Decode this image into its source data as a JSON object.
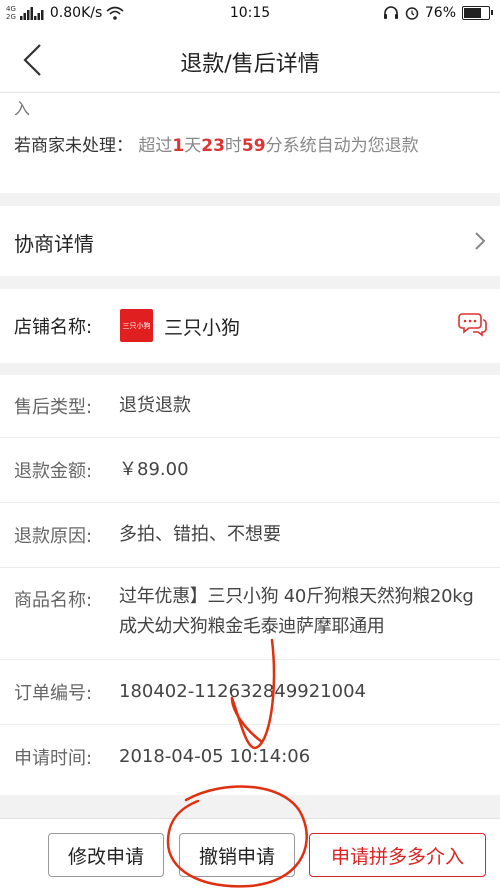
{
  "status_bar": {
    "signal_top": "4G",
    "signal_bottom": "2G",
    "network_speed": "0.80K/s",
    "time": "10:15",
    "battery": "76%",
    "battery_level": 0.76
  },
  "header": {
    "title": "退款/售后详情"
  },
  "notice": {
    "tail_text": "入",
    "label": "若商家未处理：",
    "prefix": "超过",
    "days": "1",
    "day_unit": "天",
    "hours": "23",
    "hour_unit": "时",
    "minutes": "59",
    "minute_unit": "分",
    "suffix": "系统自动为您退款"
  },
  "negotiation": {
    "label": "协商详情"
  },
  "shop": {
    "label": "店铺名称:",
    "logo_text": "三只小狗",
    "name": "三只小狗"
  },
  "details": [
    {
      "label": "售后类型:",
      "value": "退货退款"
    },
    {
      "label": "退款金额:",
      "value": "￥89.00"
    },
    {
      "label": "退款原因:",
      "value": "多拍、错拍、不想要"
    },
    {
      "label": "商品名称:",
      "value": "过年优惠】三只小狗 40斤狗粮天然狗粮20kg成犬幼犬狗粮金毛泰迪萨摩耶通用"
    },
    {
      "label": "订单编号:",
      "value": "180402-112632849921004"
    },
    {
      "label": "申请时间:",
      "value": "2018-04-05 10:14:06"
    }
  ],
  "actions": {
    "modify": "修改申请",
    "cancel": "撤销申请",
    "intervene": "申请拼多多介入"
  },
  "colors": {
    "accent_red": "#d33333",
    "annotation_red": "#e03010"
  }
}
